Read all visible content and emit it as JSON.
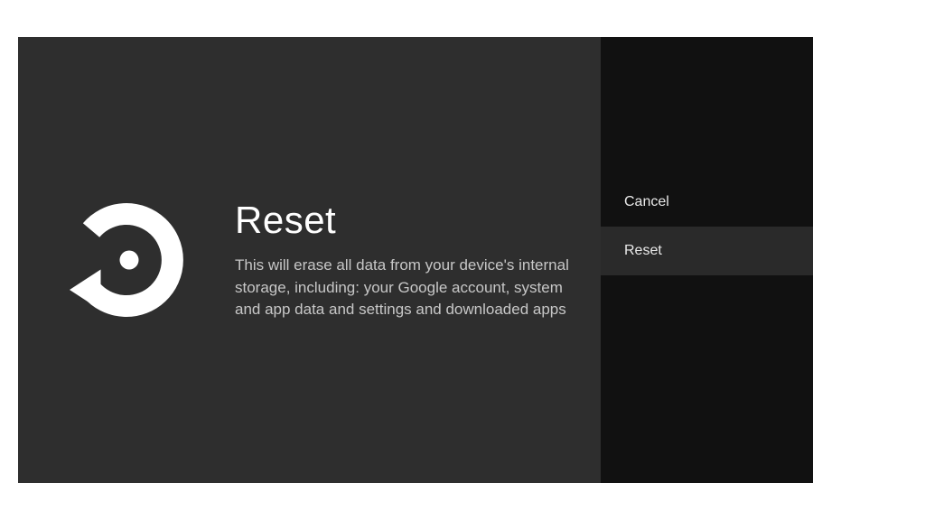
{
  "main": {
    "title": "Reset",
    "description": "This will erase all data from your device's internal storage, including: your Google account, system and app data and settings and downloaded apps",
    "icon_name": "restore-icon"
  },
  "sidebar": {
    "options": [
      {
        "label": "Cancel",
        "selected": false
      },
      {
        "label": "Reset",
        "selected": true
      }
    ]
  },
  "colors": {
    "content_bg": "#2e2e2e",
    "side_bg": "#111111",
    "text_primary": "#ffffff",
    "text_secondary": "#c7c7c7",
    "selected_bg": "#2a2a2a"
  }
}
